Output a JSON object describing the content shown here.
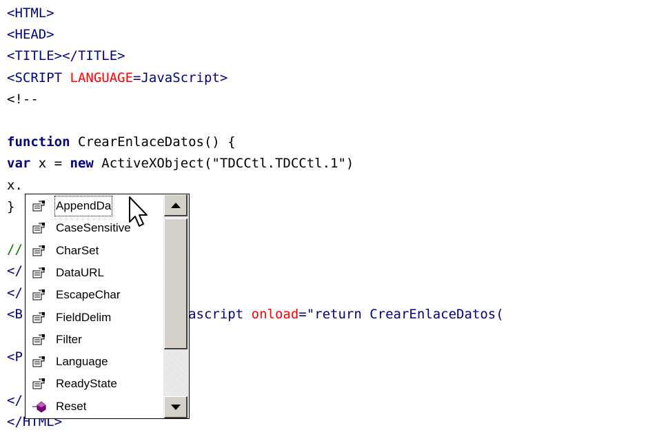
{
  "code_lines": [
    {
      "parts": [
        {
          "t": "<HTML>",
          "c": "blue"
        }
      ]
    },
    {
      "parts": [
        {
          "t": "<HEAD>",
          "c": "blue"
        }
      ]
    },
    {
      "parts": [
        {
          "t": "<TITLE></TITLE>",
          "c": "blue"
        }
      ]
    },
    {
      "parts": [
        {
          "t": "<SCRIPT ",
          "c": "blue"
        },
        {
          "t": "LANGUAGE",
          "c": "red"
        },
        {
          "t": "=JavaScript>",
          "c": "blue"
        }
      ]
    },
    {
      "parts": [
        {
          "t": "<!--",
          "c": "black"
        }
      ]
    },
    {
      "parts": []
    },
    {
      "parts": [
        {
          "t": "function",
          "c": "kw"
        },
        {
          "t": " CrearEnlaceDatos() {",
          "c": "black"
        }
      ]
    },
    {
      "parts": [
        {
          "t": "var",
          "c": "kw"
        },
        {
          "t": " x = ",
          "c": "black"
        },
        {
          "t": "new",
          "c": "kw"
        },
        {
          "t": " ActiveXObject(\"TDCCtl.TDCCtl.1\")",
          "c": "black"
        }
      ]
    },
    {
      "parts": [
        {
          "t": "x.",
          "c": "black"
        }
      ]
    },
    {
      "parts": [
        {
          "t": "}",
          "c": "black"
        }
      ]
    },
    {
      "parts": []
    },
    {
      "parts": [
        {
          "t": "//",
          "c": "green"
        }
      ]
    },
    {
      "parts": [
        {
          "t": "</",
          "c": "blue"
        }
      ]
    },
    {
      "parts": [
        {
          "t": "</",
          "c": "blue"
        }
      ]
    },
    {
      "parts": [
        {
          "t": "<B",
          "c": "blue"
        },
        {
          "t": "                   ",
          "c": "black"
        },
        {
          "t": "avascript ",
          "c": "blue"
        },
        {
          "t": "onload",
          "c": "red"
        },
        {
          "t": "=\"return CrearEnlaceDatos(",
          "c": "blue"
        }
      ]
    },
    {
      "parts": []
    },
    {
      "parts": [
        {
          "t": "<P",
          "c": "blue"
        }
      ]
    },
    {
      "parts": []
    },
    {
      "parts": [
        {
          "t": "</",
          "c": "blue"
        }
      ]
    },
    {
      "parts": [
        {
          "t": "</HTML>",
          "c": "blue"
        }
      ]
    }
  ],
  "autocomplete": {
    "items": [
      {
        "label": "AppendDa",
        "icon": "property-icon",
        "selected": true
      },
      {
        "label": "CaseSensitive",
        "icon": "property-icon"
      },
      {
        "label": "CharSet",
        "icon": "property-icon"
      },
      {
        "label": "DataURL",
        "icon": "property-icon"
      },
      {
        "label": "EscapeChar",
        "icon": "property-icon"
      },
      {
        "label": "FieldDelim",
        "icon": "property-icon"
      },
      {
        "label": "Filter",
        "icon": "property-icon"
      },
      {
        "label": "Language",
        "icon": "property-icon"
      },
      {
        "label": "ReadyState",
        "icon": "property-icon"
      },
      {
        "label": "Reset",
        "icon": "method-icon"
      }
    ]
  },
  "colors": {
    "tag": "#000080",
    "attribute": "#ff0000",
    "comment": "#008000",
    "keyword": "#000080"
  }
}
